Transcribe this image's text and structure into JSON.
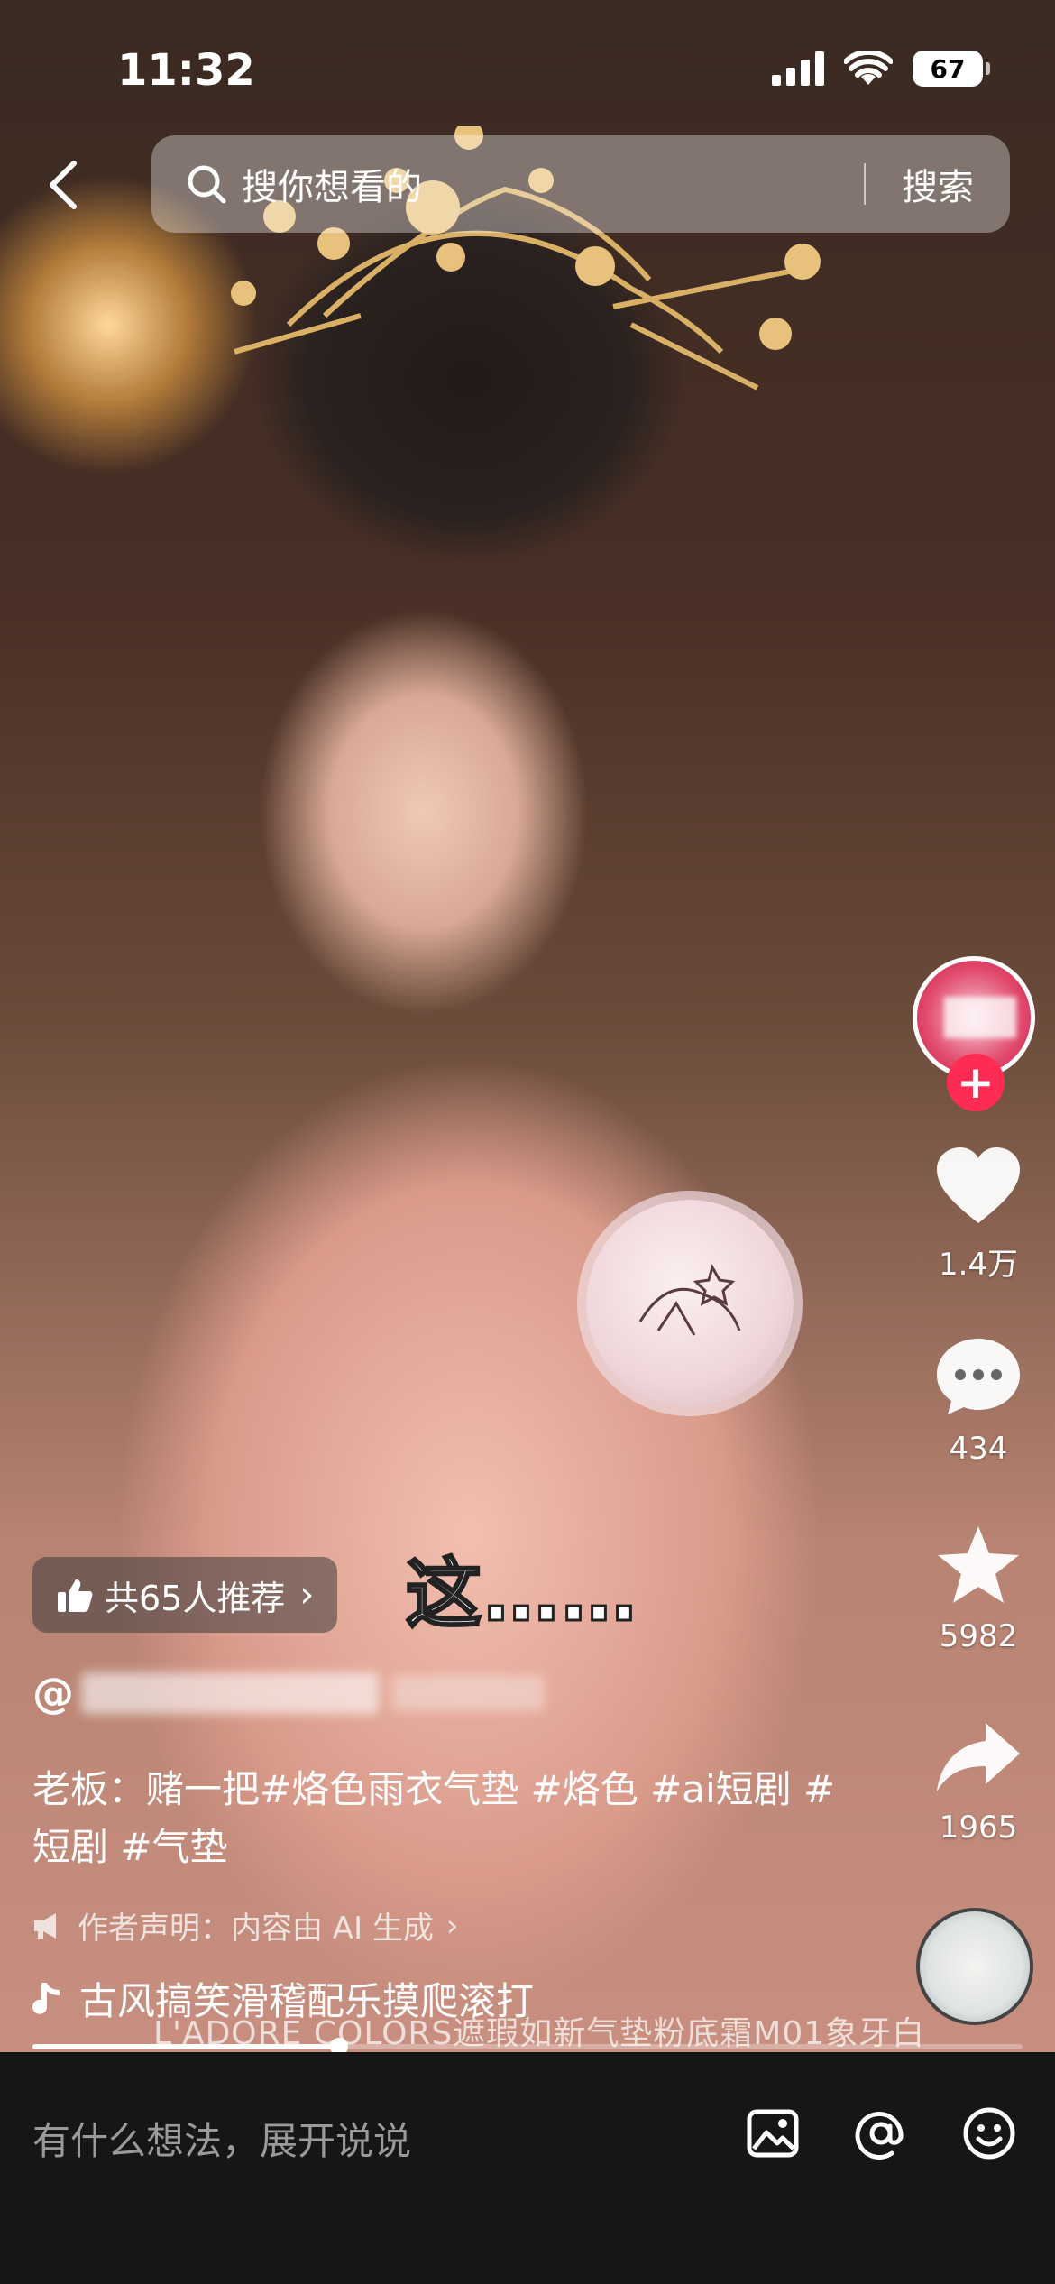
{
  "status_bar": {
    "time": "11:32",
    "battery": "67"
  },
  "search": {
    "placeholder": "搜你想看的",
    "button": "搜索"
  },
  "overlay_caption": "这……",
  "recommend": {
    "label": "共65人推荐"
  },
  "author": {
    "prefix": "@"
  },
  "description": "老板：赌一把#烙色雨衣气垫 #烙色 #ai短剧 #短剧 #气垫",
  "declaration": "作者声明：内容由 AI 生成",
  "music": "古风搞笑滑稽配乐摸爬滚打",
  "product_subtitle": "L'ADORE COLORS遮瑕如新气垫粉底霜M01象牙白",
  "actions": {
    "likes": "1.4万",
    "comments": "434",
    "favorites": "5982",
    "shares": "1965"
  },
  "progress": {
    "fraction": 0.31
  },
  "comment_bar": {
    "placeholder": "有什么想法，展开说说"
  },
  "colors": {
    "follow_accent": "#fe2c55",
    "bottom_bar": "#161616"
  },
  "icons": [
    "back-icon",
    "search-icon",
    "thumbs-up-icon",
    "heart-icon",
    "comment-icon",
    "star-icon",
    "share-icon",
    "megaphone-icon",
    "music-note-icon",
    "image-icon",
    "at-icon",
    "emoji-icon",
    "signal-icon",
    "wifi-icon"
  ]
}
